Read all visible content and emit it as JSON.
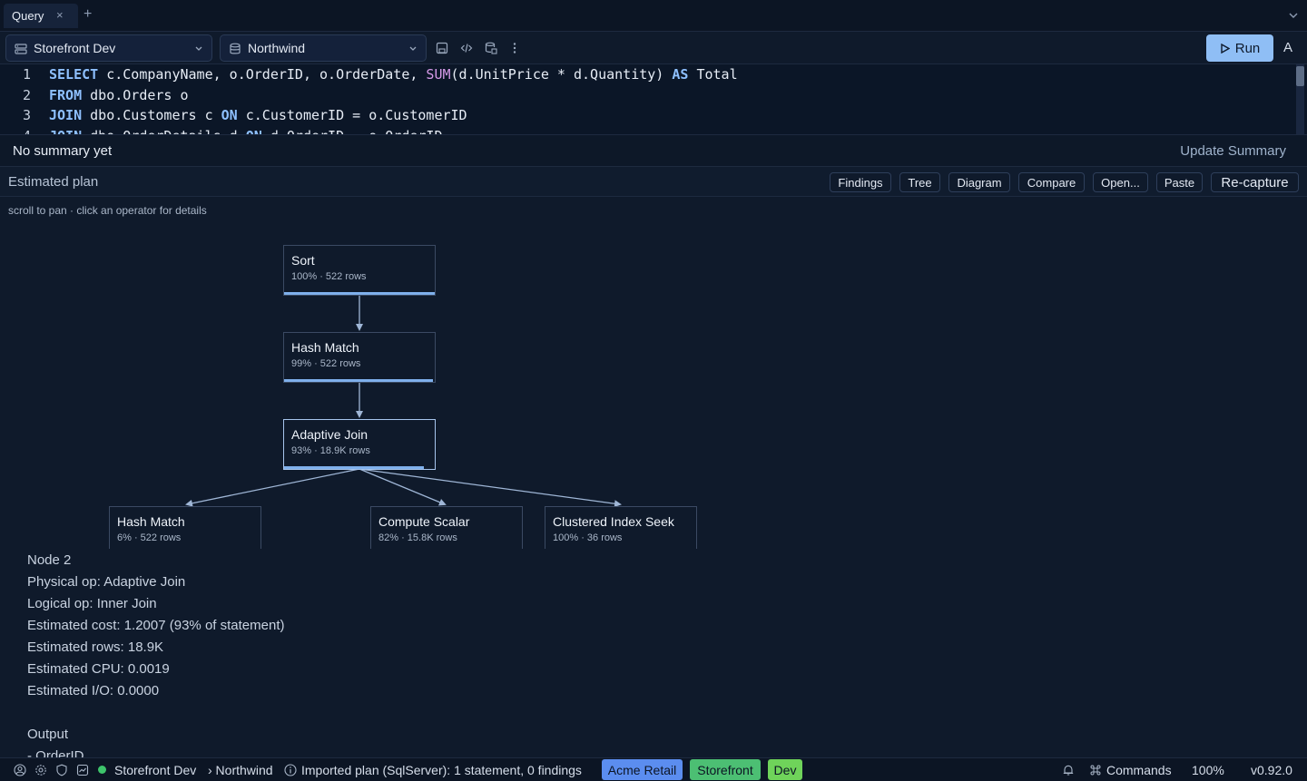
{
  "tabs": [
    {
      "label": "Query",
      "close": "×"
    }
  ],
  "tab_add": "+",
  "toolbar": {
    "connection": "Storefront Dev",
    "database": "Northwind",
    "run_label": "Run",
    "avatar_letter": "A"
  },
  "editor": {
    "lines": [
      {
        "n": "1",
        "tokens": [
          {
            "t": "SELECT",
            "c": "kw"
          },
          {
            "t": " c.CompanyName, o.OrderID, o.OrderDate, "
          },
          {
            "t": "SUM",
            "c": "fn"
          },
          {
            "t": "(d.UnitPrice * d.Quantity) "
          },
          {
            "t": "AS",
            "c": "kw"
          },
          {
            "t": " Total"
          }
        ]
      },
      {
        "n": "2",
        "tokens": [
          {
            "t": "FROM",
            "c": "kw"
          },
          {
            "t": " dbo.Orders o"
          }
        ]
      },
      {
        "n": "3",
        "tokens": [
          {
            "t": "JOIN",
            "c": "kw"
          },
          {
            "t": " dbo.Customers c "
          },
          {
            "t": "ON",
            "c": "kw"
          },
          {
            "t": " c.CustomerID = o.CustomerID"
          }
        ]
      },
      {
        "n": "4",
        "tokens": [
          {
            "t": "JOIN",
            "c": "kw"
          },
          {
            "t": " dbo.OrderDetails d "
          },
          {
            "t": "ON",
            "c": "kw"
          },
          {
            "t": " d.OrderID = o.OrderID"
          }
        ]
      }
    ]
  },
  "summary": {
    "text": "No summary yet",
    "action": "Update Summary"
  },
  "plan": {
    "title": "Estimated plan",
    "buttons": [
      "Findings",
      "Tree",
      "Diagram",
      "Compare",
      "Open...",
      "Paste",
      "Re-capture"
    ],
    "hint": "scroll to pan · click an operator for details",
    "nodes": [
      {
        "id": "sort",
        "name": "Sort",
        "stats": "100% · 522 rows",
        "cost_pct": 100
      },
      {
        "id": "hash-match-top",
        "name": "Hash Match",
        "stats": "99% · 522 rows",
        "cost_pct": 99
      },
      {
        "id": "adaptive-join",
        "name": "Adaptive Join",
        "stats": "93% · 18.9K rows",
        "cost_pct": 93
      },
      {
        "id": "hash-match-child",
        "name": "Hash Match",
        "stats": "6% · 522 rows",
        "cost_pct": 6
      },
      {
        "id": "compute-scalar",
        "name": "Compute Scalar",
        "stats": "82% · 15.8K rows",
        "cost_pct": 82
      },
      {
        "id": "clustered-index-seek",
        "name": "Clustered Index Seek",
        "stats": "100% · 36 rows",
        "cost_pct": 100
      }
    ]
  },
  "details": {
    "lines": [
      "Node 2",
      "Physical op: Adaptive Join",
      "Logical op: Inner Join",
      "Estimated cost: 1.2007 (93% of statement)",
      "Estimated rows: 18.9K",
      "Estimated CPU: 0.0019",
      "Estimated I/O: 0.0000",
      "",
      "Output",
      "- OrderID"
    ]
  },
  "status": {
    "connection": "Storefront Dev",
    "database": "› Northwind",
    "message": "Imported plan (SqlServer): 1 statement, 0 findings",
    "badges": [
      {
        "label": "Acme Retail",
        "color": "#5b8def"
      },
      {
        "label": "Storefront",
        "color": "#4cbf73"
      },
      {
        "label": "Dev",
        "color": "#6fd35a"
      }
    ],
    "commands": "Commands",
    "zoom": "100%",
    "version": "v0.92.0"
  },
  "colors": {
    "accent": "#8fbef5",
    "background": "#0f1a2b",
    "keyword": "#8ec0ff",
    "function": "#d59ae8"
  },
  "icons": [
    "server-icon",
    "database-icon",
    "save-icon",
    "code-icon",
    "database-table-icon",
    "more-vertical-icon",
    "play-icon",
    "chevron-down-icon",
    "account-icon",
    "settings-icon",
    "shield-icon",
    "chart-icon",
    "info-icon",
    "bell-icon",
    "command-icon"
  ]
}
